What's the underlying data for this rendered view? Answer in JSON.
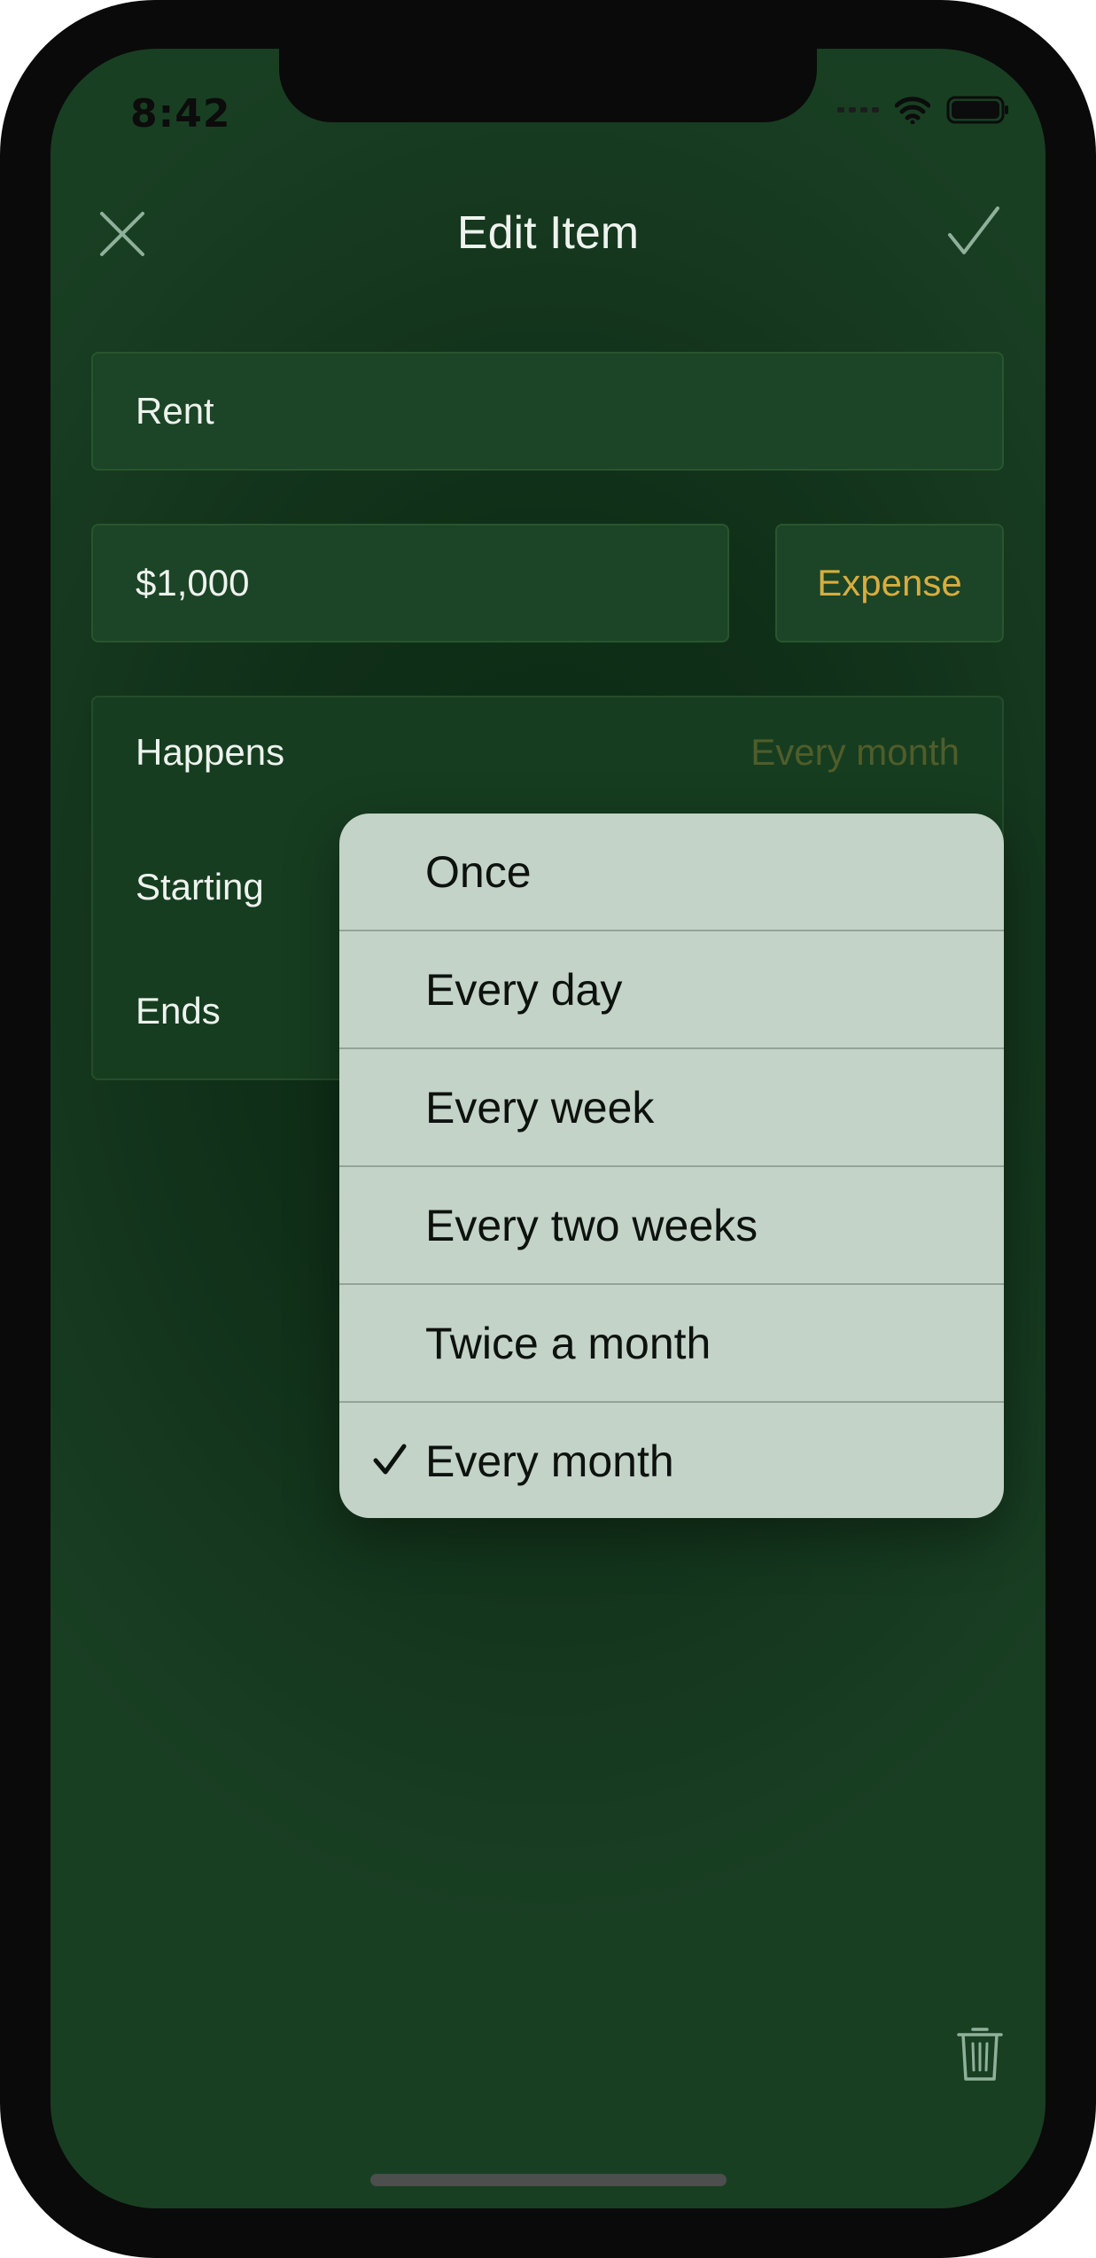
{
  "status_bar": {
    "time": "8:42",
    "icons": [
      "signal-icon",
      "wifi-icon",
      "battery-icon"
    ]
  },
  "header": {
    "title": "Edit Item",
    "close_icon": "close-icon",
    "confirm_icon": "checkmark-icon"
  },
  "form": {
    "name_value": "Rent",
    "amount_value": "$1,000",
    "type_label": "Expense",
    "schedule": {
      "happens_label": "Happens",
      "happens_value": "Every month",
      "starting_label": "Starting",
      "ends_label": "Ends"
    }
  },
  "frequency_menu": {
    "options": [
      {
        "label": "Once",
        "selected": false
      },
      {
        "label": "Every day",
        "selected": false
      },
      {
        "label": "Every week",
        "selected": false
      },
      {
        "label": "Every two weeks",
        "selected": false
      },
      {
        "label": "Twice a month",
        "selected": false
      },
      {
        "label": "Every month",
        "selected": true
      }
    ]
  },
  "footer": {
    "delete_icon": "trash-icon"
  },
  "colors": {
    "background": "#193f23",
    "field": "#1c4426",
    "accent": "#d8ad3e",
    "menu": "#c3d3c7",
    "icon": "#8fb09a"
  }
}
